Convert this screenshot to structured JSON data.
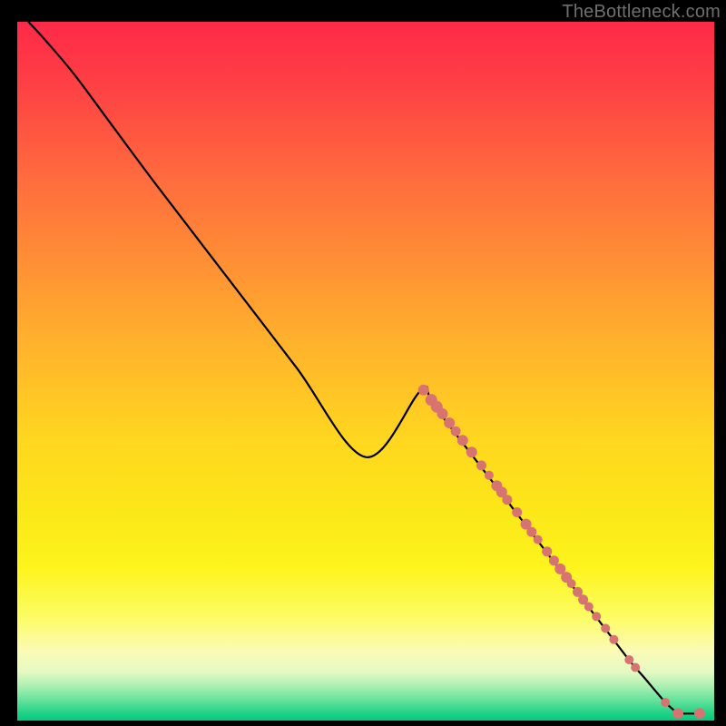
{
  "attribution": "TheBottleneck.com",
  "colors": {
    "dot_fill": "#d77370",
    "curve_stroke": "#000000",
    "background": "#000000"
  },
  "chart_data": {
    "type": "line",
    "title": "",
    "xlabel": "",
    "ylabel": "",
    "xlim": [
      0,
      100
    ],
    "ylim": [
      0,
      100
    ],
    "curve": [
      {
        "x": 1.6,
        "y": 100.0
      },
      {
        "x": 4.0,
        "y": 97.4
      },
      {
        "x": 8.0,
        "y": 92.7
      },
      {
        "x": 13.0,
        "y": 86.0
      },
      {
        "x": 20.0,
        "y": 76.6
      },
      {
        "x": 30.0,
        "y": 63.6
      },
      {
        "x": 40.0,
        "y": 50.6
      },
      {
        "x": 50.0,
        "y": 37.7
      },
      {
        "x": 58.0,
        "y": 47.3
      },
      {
        "x": 60.0,
        "y": 44.8
      },
      {
        "x": 70.0,
        "y": 31.8
      },
      {
        "x": 76.0,
        "y": 24.0
      },
      {
        "x": 80.0,
        "y": 18.8
      },
      {
        "x": 85.0,
        "y": 12.3
      },
      {
        "x": 88.0,
        "y": 8.4
      },
      {
        "x": 90.0,
        "y": 6.1
      },
      {
        "x": 93.0,
        "y": 2.6
      },
      {
        "x": 94.8,
        "y": 1.0
      },
      {
        "x": 97.9,
        "y": 1.0
      }
    ],
    "series": [
      {
        "name": "points",
        "values": [
          {
            "x": 58.3,
            "y": 47.3,
            "r": 6.0
          },
          {
            "x": 59.4,
            "y": 45.9,
            "r": 6.5
          },
          {
            "x": 60.2,
            "y": 44.9,
            "r": 6.5
          },
          {
            "x": 61.0,
            "y": 43.9,
            "r": 6.0
          },
          {
            "x": 62.0,
            "y": 42.6,
            "r": 6.0
          },
          {
            "x": 62.9,
            "y": 41.4,
            "r": 5.5
          },
          {
            "x": 63.9,
            "y": 40.1,
            "r": 6.0
          },
          {
            "x": 65.2,
            "y": 38.4,
            "r": 6.0
          },
          {
            "x": 66.6,
            "y": 36.5,
            "r": 5.5
          },
          {
            "x": 67.7,
            "y": 35.1,
            "r": 5.0
          },
          {
            "x": 68.8,
            "y": 33.6,
            "r": 6.0
          },
          {
            "x": 69.5,
            "y": 32.7,
            "r": 6.0
          },
          {
            "x": 70.3,
            "y": 31.6,
            "r": 5.5
          },
          {
            "x": 71.7,
            "y": 29.8,
            "r": 5.5
          },
          {
            "x": 73.0,
            "y": 28.1,
            "r": 6.0
          },
          {
            "x": 73.8,
            "y": 27.0,
            "r": 5.5
          },
          {
            "x": 74.7,
            "y": 25.9,
            "r": 5.0
          },
          {
            "x": 76.0,
            "y": 24.2,
            "r": 5.5
          },
          {
            "x": 77.0,
            "y": 22.9,
            "r": 5.5
          },
          {
            "x": 77.9,
            "y": 21.7,
            "r": 6.0
          },
          {
            "x": 78.8,
            "y": 20.5,
            "r": 6.0
          },
          {
            "x": 79.5,
            "y": 19.6,
            "r": 5.0
          },
          {
            "x": 80.4,
            "y": 18.4,
            "r": 5.5
          },
          {
            "x": 81.2,
            "y": 17.3,
            "r": 5.5
          },
          {
            "x": 82.0,
            "y": 16.3,
            "r": 5.0
          },
          {
            "x": 83.1,
            "y": 14.9,
            "r": 5.0
          },
          {
            "x": 84.4,
            "y": 13.2,
            "r": 5.0
          },
          {
            "x": 85.6,
            "y": 11.6,
            "r": 5.0
          },
          {
            "x": 87.8,
            "y": 8.7,
            "r": 5.0
          },
          {
            "x": 88.7,
            "y": 7.6,
            "r": 5.0
          },
          {
            "x": 93.0,
            "y": 2.6,
            "r": 5.0
          },
          {
            "x": 94.8,
            "y": 1.0,
            "r": 6.0
          },
          {
            "x": 97.9,
            "y": 1.0,
            "r": 6.0
          }
        ]
      }
    ]
  }
}
